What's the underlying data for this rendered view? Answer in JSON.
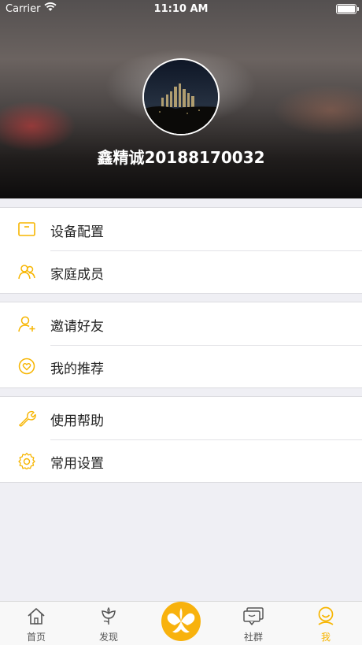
{
  "status_bar": {
    "carrier": "Carrier",
    "time": "11:10 AM"
  },
  "profile": {
    "username": "鑫精诚20188170032"
  },
  "menu_sections": [
    {
      "items": [
        {
          "label": "设备配置",
          "icon": "device-box-icon"
        },
        {
          "label": "家庭成员",
          "icon": "family-members-icon"
        }
      ]
    },
    {
      "items": [
        {
          "label": "邀请好友",
          "icon": "add-friend-icon"
        },
        {
          "label": "我的推荐",
          "icon": "heart-circle-icon"
        }
      ]
    },
    {
      "items": [
        {
          "label": "使用帮助",
          "icon": "wrench-icon"
        },
        {
          "label": "常用设置",
          "icon": "gear-icon"
        }
      ]
    }
  ],
  "tab_bar": {
    "tabs": [
      {
        "label": "首页",
        "icon": "home-icon"
      },
      {
        "label": "发现",
        "icon": "discover-flower-icon"
      },
      {
        "label": "",
        "icon": "center-logo-icon"
      },
      {
        "label": "社群",
        "icon": "community-chat-icon"
      },
      {
        "label": "我",
        "icon": "me-smile-icon",
        "active": true
      }
    ]
  },
  "colors": {
    "accent": "#f7b500",
    "background": "#efeff4"
  }
}
